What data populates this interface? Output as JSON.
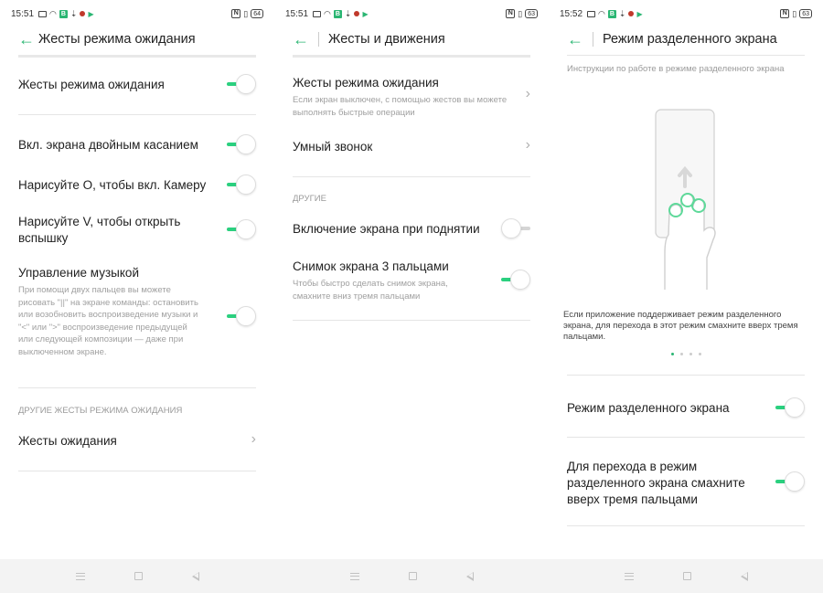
{
  "colors": {
    "accent": "#2bb673",
    "toggle_on": "#2bd07f",
    "toggle_off": "#d5d5d5"
  },
  "screens": [
    {
      "status": {
        "time": "15:51",
        "battery": "64"
      },
      "title": "Жесты режима ожидания",
      "items": [
        {
          "label": "Жесты режима ожидания",
          "toggle": true
        },
        {
          "label": "Вкл. экрана двойным касанием",
          "toggle": true
        },
        {
          "label": "Нарисуйте O, чтобы вкл. Камеру",
          "toggle": true
        },
        {
          "label": "Нарисуйте V, чтобы открыть вспышку",
          "toggle": true
        },
        {
          "label": "Управление музыкой",
          "sub": "При помощи двух пальцев вы можете рисовать \"||\" на экране команды: остановить или возобновить воспроизведение музыки и \"<\" или \">\" воспроизведение предыдущей или следующей композиции — даже при выключенном экране.",
          "toggle": true
        }
      ],
      "section": "ДРУГИЕ ЖЕСТЫ РЕЖИМА ОЖИДАНИЯ",
      "link": "Жесты ожидания"
    },
    {
      "status": {
        "time": "15:51",
        "battery": "63"
      },
      "title": "Жесты и движения",
      "items": [
        {
          "label": "Жесты режима ожидания",
          "sub": "Если экран выключен, с помощью жестов вы можете выполнять быстрые операции"
        },
        {
          "label": "Умный звонок"
        },
        {
          "label": "Включение экрана при поднятии",
          "toggle": false
        },
        {
          "label": "Снимок экрана 3 пальцами",
          "sub": "Чтобы быстро сделать снимок экрана, смахните вниз тремя пальцами",
          "toggle": true
        }
      ],
      "section": "ДРУГИЕ"
    },
    {
      "status": {
        "time": "15:52",
        "battery": "63"
      },
      "title": "Режим разделенного экрана",
      "instructions_heading": "Инструкции по работе в режиме разделенного экрана",
      "illustration_text": "Если приложение поддерживает режим разделенного экрана, для перехода в этот режим смахните вверх тремя пальцами.",
      "carousel": {
        "pages": 4,
        "active": 1
      },
      "items": [
        {
          "label": "Режим разделенного экрана",
          "toggle": true
        },
        {
          "label": "Для перехода в режим разделенного экрана смахните вверх тремя пальцами",
          "toggle": true
        }
      ]
    }
  ]
}
